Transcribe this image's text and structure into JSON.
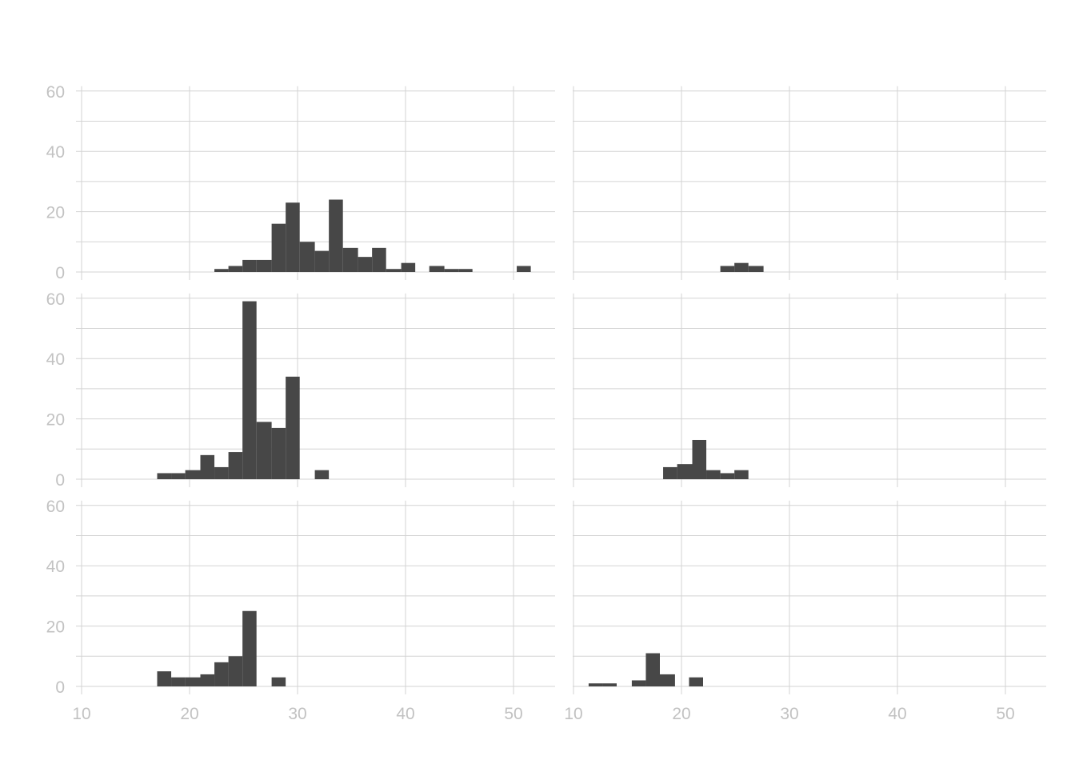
{
  "chart_data": {
    "type": "bar",
    "layout": "facet grid, 3 rows x 2 columns, shared axes",
    "x_ticks": [
      10,
      20,
      30,
      40,
      50
    ],
    "y_ticks": [
      0,
      20,
      40,
      60
    ],
    "xlim": [
      10,
      53
    ],
    "ylim": [
      0,
      60
    ],
    "bin_width": 1.33,
    "grid": true,
    "colors": {
      "bar": "#474747",
      "grid": "#d3d3d3",
      "tick_label": "#c2c2c2",
      "background": "#ffffff"
    },
    "panels": [
      {
        "row": 1,
        "col": 1,
        "bins": [
          {
            "start": 22.3,
            "end": 23.6,
            "count": 1
          },
          {
            "start": 23.6,
            "end": 24.9,
            "count": 2
          },
          {
            "start": 24.9,
            "end": 26.2,
            "count": 4
          },
          {
            "start": 26.2,
            "end": 27.6,
            "count": 4
          },
          {
            "start": 27.6,
            "end": 28.9,
            "count": 16
          },
          {
            "start": 28.9,
            "end": 30.2,
            "count": 23
          },
          {
            "start": 30.2,
            "end": 31.6,
            "count": 10
          },
          {
            "start": 31.6,
            "end": 32.9,
            "count": 7
          },
          {
            "start": 32.9,
            "end": 34.2,
            "count": 24
          },
          {
            "start": 34.2,
            "end": 35.6,
            "count": 8
          },
          {
            "start": 35.6,
            "end": 36.9,
            "count": 5
          },
          {
            "start": 36.9,
            "end": 38.2,
            "count": 8
          },
          {
            "start": 38.2,
            "end": 39.6,
            "count": 1
          },
          {
            "start": 39.6,
            "end": 40.9,
            "count": 3
          },
          {
            "start": 42.2,
            "end": 43.6,
            "count": 2
          },
          {
            "start": 43.6,
            "end": 44.9,
            "count": 1
          },
          {
            "start": 44.9,
            "end": 46.2,
            "count": 1
          },
          {
            "start": 50.3,
            "end": 51.6,
            "count": 2
          }
        ]
      },
      {
        "row": 1,
        "col": 2,
        "bins": [
          {
            "start": 23.6,
            "end": 24.9,
            "count": 2
          },
          {
            "start": 24.9,
            "end": 26.2,
            "count": 3
          },
          {
            "start": 26.2,
            "end": 27.6,
            "count": 2
          }
        ]
      },
      {
        "row": 2,
        "col": 1,
        "bins": [
          {
            "start": 17.0,
            "end": 18.3,
            "count": 2
          },
          {
            "start": 18.3,
            "end": 19.6,
            "count": 2
          },
          {
            "start": 19.6,
            "end": 21.0,
            "count": 3
          },
          {
            "start": 21.0,
            "end": 22.3,
            "count": 8
          },
          {
            "start": 22.3,
            "end": 23.6,
            "count": 4
          },
          {
            "start": 23.6,
            "end": 24.9,
            "count": 9
          },
          {
            "start": 24.9,
            "end": 26.2,
            "count": 59
          },
          {
            "start": 26.2,
            "end": 27.6,
            "count": 19
          },
          {
            "start": 27.6,
            "end": 28.9,
            "count": 17
          },
          {
            "start": 28.9,
            "end": 30.2,
            "count": 34
          },
          {
            "start": 31.6,
            "end": 32.9,
            "count": 3
          }
        ]
      },
      {
        "row": 2,
        "col": 2,
        "bins": [
          {
            "start": 18.3,
            "end": 19.6,
            "count": 4
          },
          {
            "start": 19.6,
            "end": 21.0,
            "count": 5
          },
          {
            "start": 21.0,
            "end": 22.3,
            "count": 13
          },
          {
            "start": 22.3,
            "end": 23.6,
            "count": 3
          },
          {
            "start": 23.6,
            "end": 24.9,
            "count": 2
          },
          {
            "start": 24.9,
            "end": 26.2,
            "count": 3
          }
        ]
      },
      {
        "row": 3,
        "col": 1,
        "bins": [
          {
            "start": 17.0,
            "end": 18.3,
            "count": 5
          },
          {
            "start": 18.3,
            "end": 19.6,
            "count": 3
          },
          {
            "start": 19.6,
            "end": 21.0,
            "count": 3
          },
          {
            "start": 21.0,
            "end": 22.3,
            "count": 4
          },
          {
            "start": 22.3,
            "end": 23.6,
            "count": 8
          },
          {
            "start": 23.6,
            "end": 24.9,
            "count": 10
          },
          {
            "start": 24.9,
            "end": 26.2,
            "count": 25
          },
          {
            "start": 27.6,
            "end": 28.9,
            "count": 3
          }
        ]
      },
      {
        "row": 3,
        "col": 2,
        "bins": [
          {
            "start": 11.4,
            "end": 12.7,
            "count": 1
          },
          {
            "start": 12.7,
            "end": 14.0,
            "count": 1
          },
          {
            "start": 15.4,
            "end": 16.7,
            "count": 2
          },
          {
            "start": 16.7,
            "end": 18.0,
            "count": 11
          },
          {
            "start": 18.0,
            "end": 19.4,
            "count": 4
          },
          {
            "start": 20.7,
            "end": 22.0,
            "count": 3
          }
        ]
      }
    ]
  }
}
